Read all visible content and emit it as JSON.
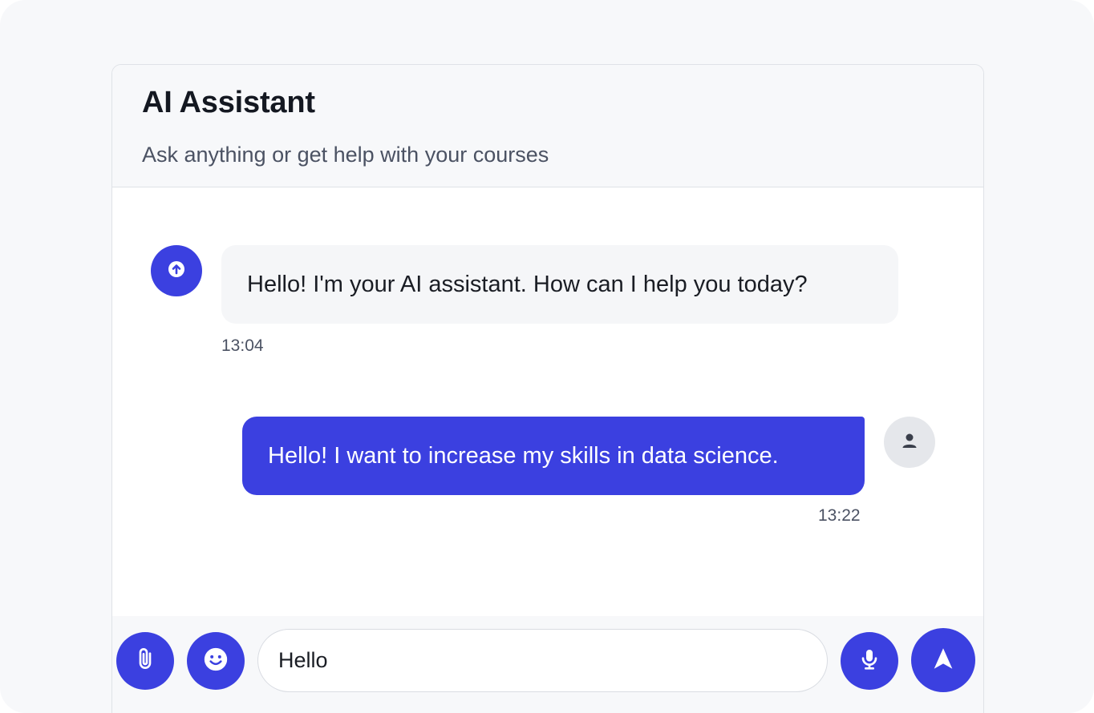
{
  "header": {
    "title": "AI Assistant",
    "subtitle": "Ask anything or get help with your courses"
  },
  "messages": [
    {
      "sender": "assistant",
      "avatar_icon": "assistant-icon",
      "text": "Hello! I'm your AI assistant. How can I help you today?",
      "time": "13:04"
    },
    {
      "sender": "user",
      "avatar_icon": "user-icon",
      "text": "Hello! I want to increase my skills in data science.",
      "time": "13:22"
    }
  ],
  "composer": {
    "input_value": "Hello",
    "attach_icon": "paperclip-icon",
    "emoji_icon": "smiley-icon",
    "mic_icon": "microphone-icon",
    "send_icon": "send-icon"
  },
  "colors": {
    "accent": "#3b40e0",
    "page_background": "#f7f8fa",
    "user_avatar_bg": "#e5e7eb"
  }
}
